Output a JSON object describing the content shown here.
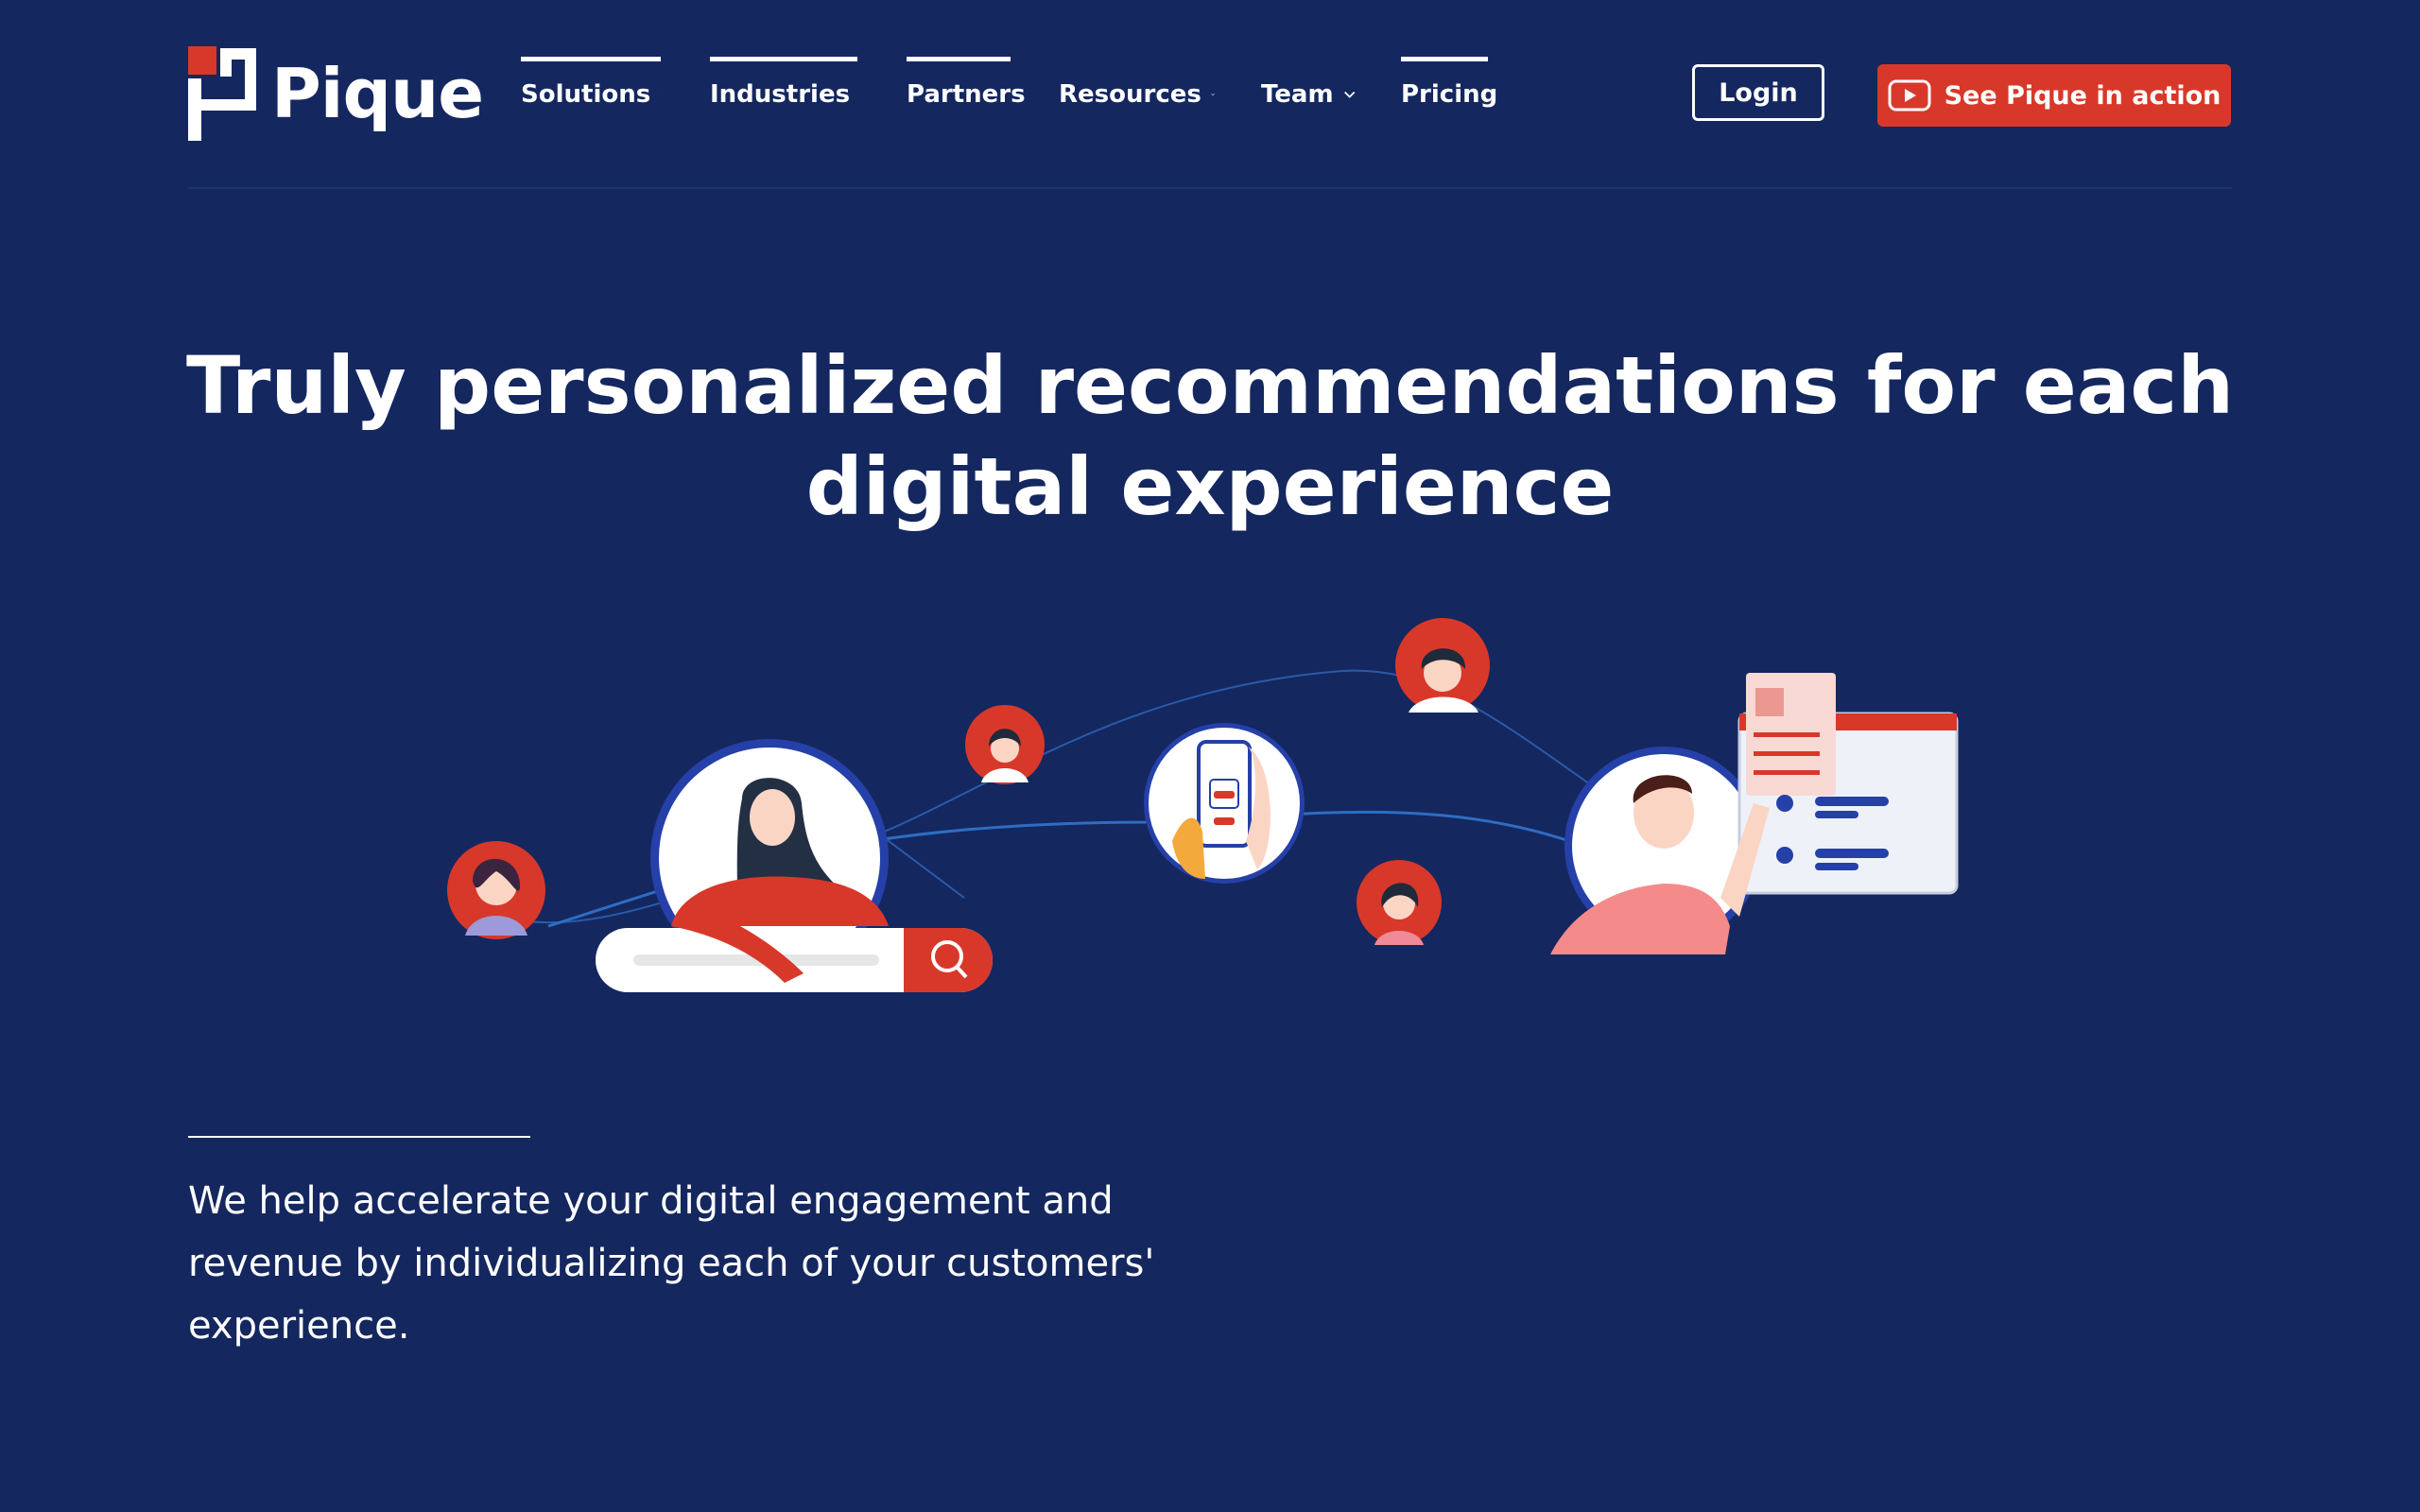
{
  "brand": {
    "name": "Pique",
    "colors": {
      "background": "#14275f",
      "accent": "#d8382a",
      "text": "#ffffff"
    }
  },
  "nav": {
    "items": [
      {
        "label": "Solutions",
        "dropdown": true,
        "active": true
      },
      {
        "label": "Industries",
        "dropdown": true,
        "active": true
      },
      {
        "label": "Partners",
        "dropdown": false,
        "active": true
      },
      {
        "label": "Resources",
        "dropdown": true,
        "active": false
      },
      {
        "label": "Team",
        "dropdown": true,
        "active": false
      },
      {
        "label": "Pricing",
        "dropdown": false,
        "active": true
      }
    ],
    "login_label": "Login",
    "cta_label": "See Pique in action",
    "cta_icon": "play-icon"
  },
  "hero": {
    "headline_line1": "Truly personalized recommendations for each",
    "headline_line2": "digital experience",
    "illustration_icon": "personalization-network-illustration"
  },
  "intro": {
    "text": "We help accelerate your digital engagement and revenue by individualizing each of your customers' experience."
  }
}
